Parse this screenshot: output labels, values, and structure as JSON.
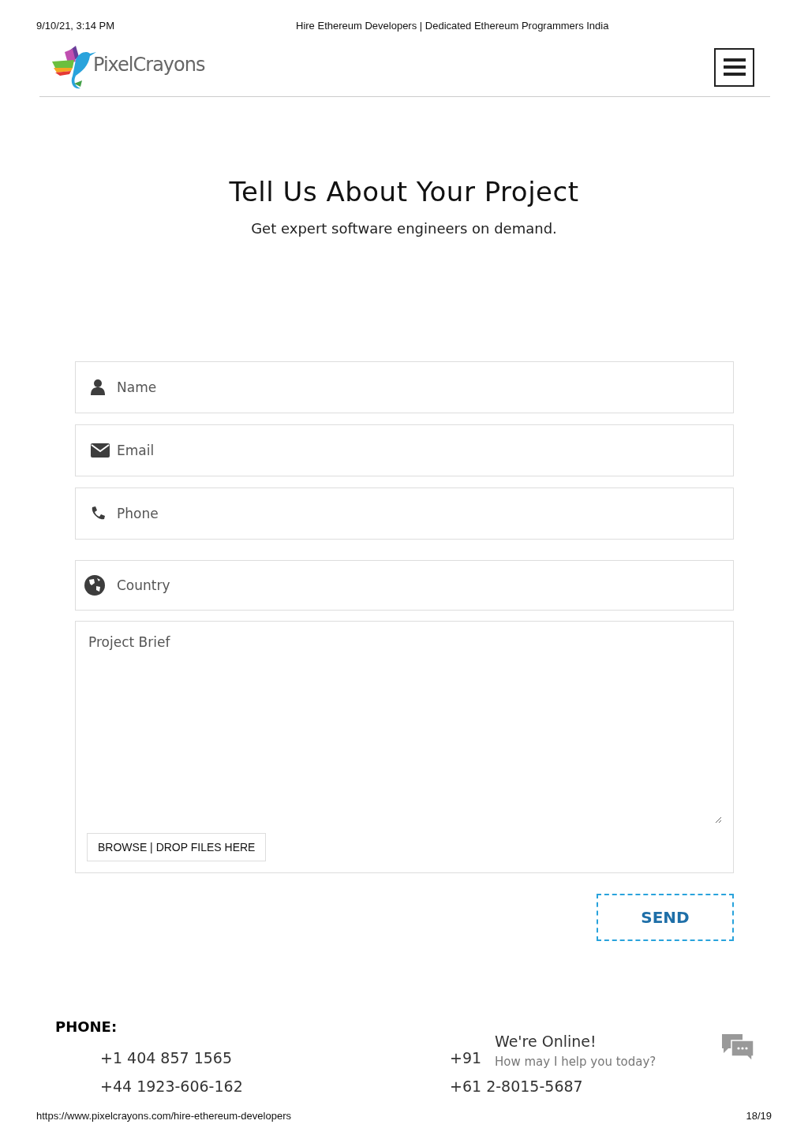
{
  "print_header": {
    "date": "9/10/21, 3:14 PM",
    "title": "Hire Ethereum Developers | Dedicated Ethereum Programmers India"
  },
  "logo": {
    "text": "PixelCrayons"
  },
  "hero": {
    "title": "Tell Us About Your Project",
    "subtitle": "Get expert software engineers on demand."
  },
  "form": {
    "fields": [
      {
        "kind": "name",
        "placeholder": "Name"
      },
      {
        "kind": "email",
        "placeholder": "Email"
      },
      {
        "kind": "phone",
        "placeholder": "Phone"
      },
      {
        "kind": "country",
        "placeholder": "Country"
      }
    ],
    "brief": {
      "placeholder": "Project Brief",
      "upload": "BROWSE | DROP FILES HERE"
    },
    "submit": "SEND"
  },
  "contact": {
    "heading": "PHONE:",
    "numbers": [
      [
        "+1 404 857 1565",
        "+91"
      ],
      [
        "+44 1923-606-162",
        "+61 2-8015-5687"
      ]
    ]
  },
  "chat": {
    "title": "We're Online!",
    "message": "How may I help you today?"
  },
  "print_footer": {
    "url": "https://www.pixelcrayons.com/hire-ethereum-developers",
    "page": "18/19"
  }
}
